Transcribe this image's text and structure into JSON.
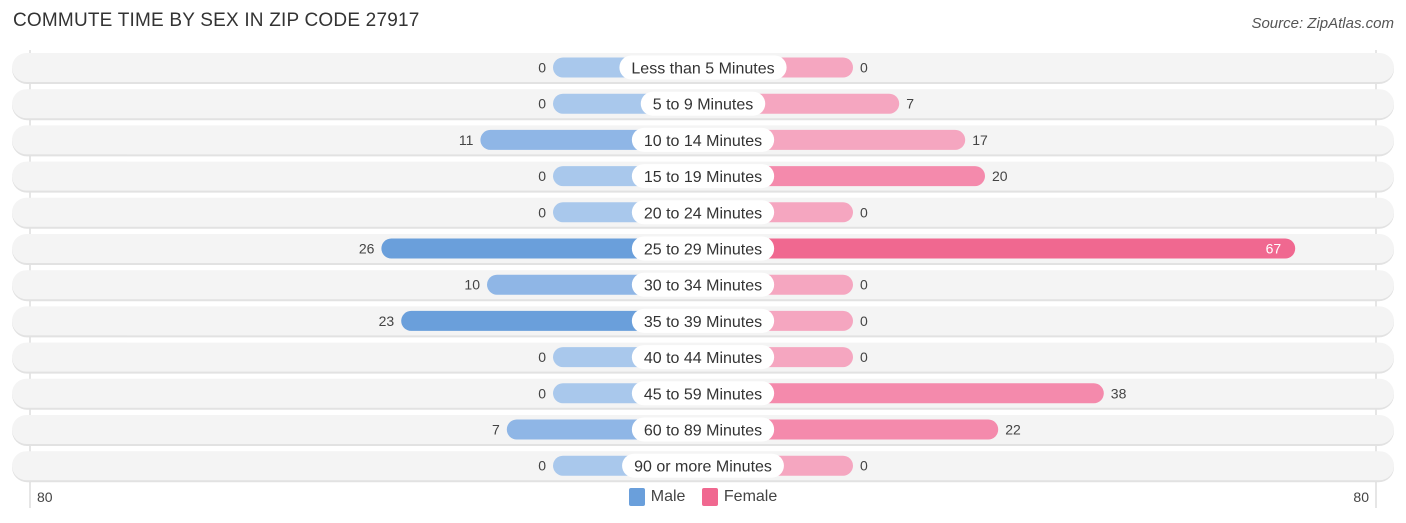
{
  "title": "COMMUTE TIME BY SEX IN ZIP CODE 27917",
  "source": "Source: ZipAtlas.com",
  "colors": {
    "male": "#6a9fdb",
    "male_light": "#a9c8ec",
    "female": "#f06890",
    "female_light": "#f5a6c0"
  },
  "chart_data": {
    "type": "bar",
    "orientation": "horizontal-diverging",
    "title": "COMMUTE TIME BY SEX IN ZIP CODE 27917",
    "categories": [
      "Less than 5 Minutes",
      "5 to 9 Minutes",
      "10 to 14 Minutes",
      "15 to 19 Minutes",
      "20 to 24 Minutes",
      "25 to 29 Minutes",
      "30 to 34 Minutes",
      "35 to 39 Minutes",
      "40 to 44 Minutes",
      "45 to 59 Minutes",
      "60 to 89 Minutes",
      "90 or more Minutes"
    ],
    "series": [
      {
        "name": "Male",
        "values": [
          0,
          0,
          11,
          0,
          0,
          26,
          10,
          23,
          0,
          0,
          7,
          0
        ]
      },
      {
        "name": "Female",
        "values": [
          0,
          7,
          17,
          20,
          0,
          67,
          0,
          0,
          0,
          38,
          22,
          0
        ]
      }
    ],
    "axis": {
      "left_label": "80",
      "right_label": "80",
      "max": 80
    },
    "legend": {
      "position": "bottom-center",
      "entries": [
        "Male",
        "Female"
      ]
    }
  }
}
